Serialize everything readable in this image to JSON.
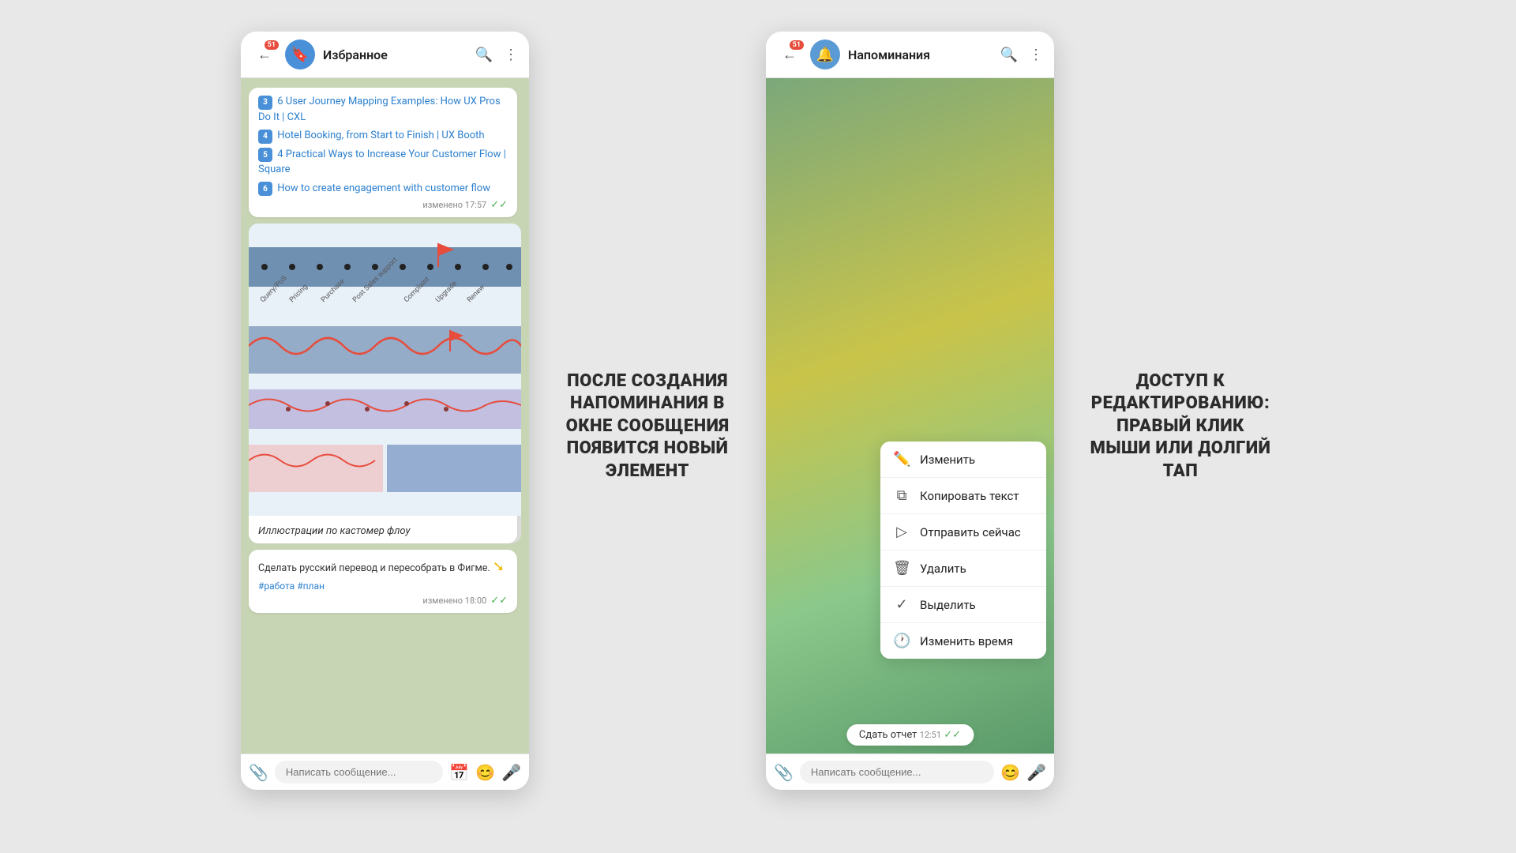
{
  "left_phone": {
    "header": {
      "back_badge": "51",
      "title": "Избранное",
      "search_label": "search",
      "menu_label": "menu"
    },
    "messages": [
      {
        "id": "links-message",
        "items": [
          {
            "num": "3",
            "text": "6 User Journey Mapping Examples: How UX Pros Do It | CXL"
          },
          {
            "num": "4",
            "text": "Hotel Booking, from Start to Finish | UX Booth"
          },
          {
            "num": "5",
            "text": "4 Practical Ways to Increase Your Customer Flow | Square"
          },
          {
            "num": "6",
            "text": "How to create engagement with customer flow"
          }
        ],
        "meta_label": "изменено 17:57",
        "check": "✓✓"
      },
      {
        "id": "caption-message",
        "caption": "Иллюстрации по кастомер флоу"
      },
      {
        "id": "task-message",
        "text": "Сделать русский перевод и пересобрать в Фигме.",
        "tags": "#работа #план",
        "meta_label": "изменено 18:00",
        "check": "✓✓"
      }
    ],
    "input": {
      "placeholder": "Написать сообщение..."
    }
  },
  "annotation_left": {
    "text": "ПОСЛЕ СОЗДАНИЯ НАПОМИНАНИЯ В ОКНЕ СООБЩЕНИЯ ПОЯВИТСЯ НОВЫЙ ЭЛЕМЕНТ"
  },
  "right_phone": {
    "header": {
      "back_badge": "51",
      "title": "Напоминания"
    },
    "context_menu": {
      "items": [
        {
          "icon": "✏️",
          "label": "Изменить"
        },
        {
          "icon": "📋",
          "label": "Копировать текст"
        },
        {
          "icon": "➤",
          "label": "Отправить сейчас"
        },
        {
          "icon": "🗑️",
          "label": "Удалить"
        },
        {
          "icon": "✅",
          "label": "Выделить"
        },
        {
          "icon": "🕐",
          "label": "Изменить время"
        }
      ]
    },
    "report_button": "Сдать отчет",
    "report_time": "12:51",
    "input": {
      "placeholder": "Написать сообщение..."
    }
  },
  "annotation_right": {
    "text": "ДОСТУП К РЕДАКТИРОВАНИЮ: ПРАВЫЙ КЛИК МЫШИ ИЛИ ДОЛГИЙ ТАП"
  }
}
